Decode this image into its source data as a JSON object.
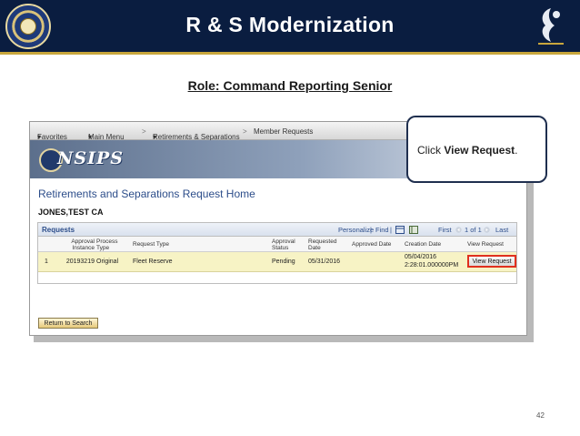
{
  "slide": {
    "title": "R & S Modernization",
    "role": "Role: Command Reporting Senior",
    "page_number": "42"
  },
  "callout": {
    "prefix": "Click ",
    "emphasis": "View Request",
    "suffix": "."
  },
  "nav": {
    "favorites": "Favorites",
    "main_menu": "Main Menu",
    "sep1": ">",
    "retirements": "Retirements & Separations",
    "sep2": ">",
    "member_requests": "Member Requests",
    "caret": "▾"
  },
  "app": {
    "logo_text": "NSIPS",
    "page_heading": "Retirements and Separations Request Home",
    "person_name": "JONES,TEST CA"
  },
  "grid": {
    "title": "Requests",
    "personalize": "Personalize",
    "find": "Find",
    "first": "First",
    "pagination": "1 of 1",
    "last": "Last",
    "columns": {
      "approval_instance": "Approval Instance",
      "process_type": "Process Type",
      "request_type": "Request Type",
      "approval_status": "Approval Status",
      "requested_date": "Requested Date",
      "approved_date": "Approved Date",
      "creation_date": "Creation Date",
      "view_request": "View Request"
    },
    "rows": [
      {
        "row_num": "1",
        "approval_instance": "20193219",
        "process_type": "Original",
        "request_type": "Fleet Reserve",
        "approval_status": "Pending",
        "requested_date": "05/31/2016",
        "approved_date": "",
        "creation_date": "05/04/2016",
        "creation_time": "2:28:01.000000PM",
        "view_button": "View Request"
      }
    ]
  },
  "buttons": {
    "return_to_search": "Return to Search"
  },
  "colors": {
    "header_navy": "#0a1d40",
    "gold_rule": "#c8a63c",
    "highlight_red": "#e0301e",
    "row_highlight": "#f7f3c5",
    "link_blue": "#2c4d8a"
  }
}
